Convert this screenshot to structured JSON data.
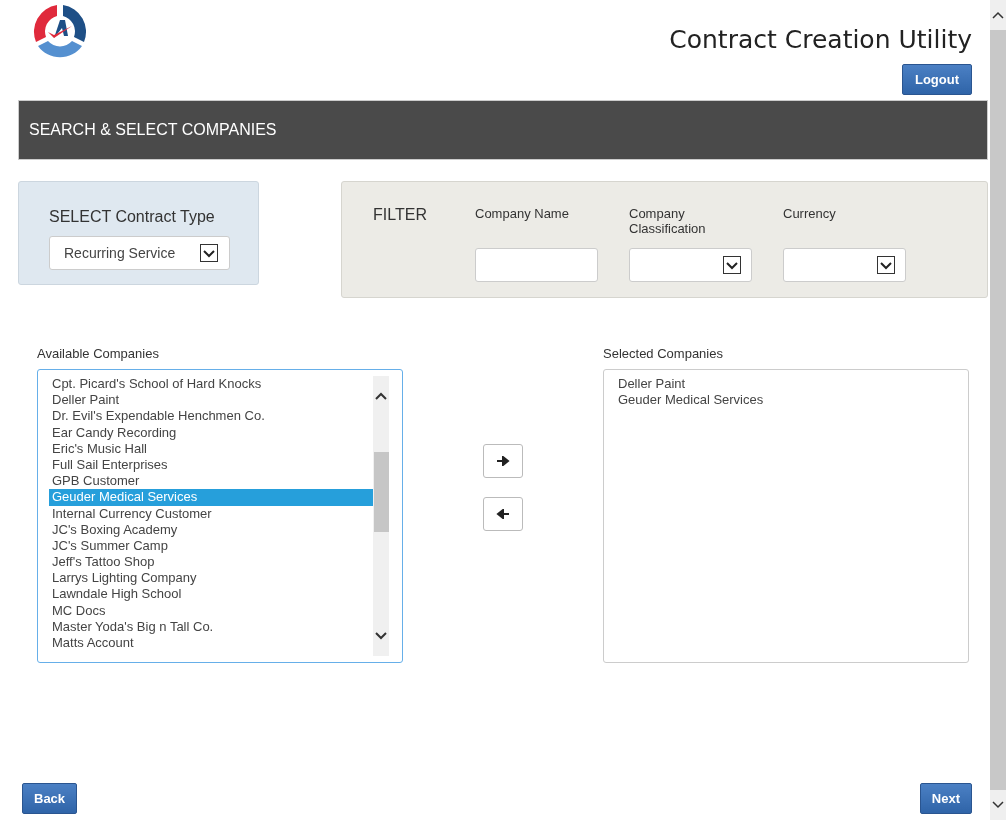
{
  "header": {
    "title": "Contract Creation Utility",
    "logout": "Logout"
  },
  "banner": "SEARCH & SELECT COMPANIES",
  "contract_type": {
    "label": "SELECT Contract Type",
    "value": "Recurring Service"
  },
  "filter": {
    "title": "FILTER",
    "fields": [
      {
        "label": "Company Name",
        "kind": "text"
      },
      {
        "label": "Company Classification",
        "kind": "select"
      },
      {
        "label": "Currency",
        "kind": "select"
      }
    ]
  },
  "available": {
    "label": "Available Companies",
    "items": [
      {
        "name": "Cpt. Picard's School of Hard Knocks",
        "selected": false
      },
      {
        "name": "Deller Paint",
        "selected": false
      },
      {
        "name": "Dr. Evil's Expendable Henchmen Co.",
        "selected": false
      },
      {
        "name": "Ear Candy Recording",
        "selected": false
      },
      {
        "name": "Eric's Music Hall",
        "selected": false
      },
      {
        "name": "Full Sail Enterprises",
        "selected": false
      },
      {
        "name": "GPB Customer",
        "selected": false
      },
      {
        "name": "Geuder Medical Services",
        "selected": true
      },
      {
        "name": "Internal Currency Customer",
        "selected": false
      },
      {
        "name": "JC's Boxing Academy",
        "selected": false
      },
      {
        "name": "JC's Summer Camp",
        "selected": false
      },
      {
        "name": "Jeff's Tattoo Shop",
        "selected": false
      },
      {
        "name": "Larrys Lighting Company",
        "selected": false
      },
      {
        "name": "Lawndale High School",
        "selected": false
      },
      {
        "name": "MC Docs",
        "selected": false
      },
      {
        "name": "Master Yoda's Big n Tall Co.",
        "selected": false
      },
      {
        "name": "Matts Account",
        "selected": false
      }
    ]
  },
  "selected_companies": {
    "label": "Selected Companies",
    "items": [
      "Deller Paint",
      "Geuder Medical Services"
    ]
  },
  "buttons": {
    "back": "Back",
    "next": "Next"
  }
}
